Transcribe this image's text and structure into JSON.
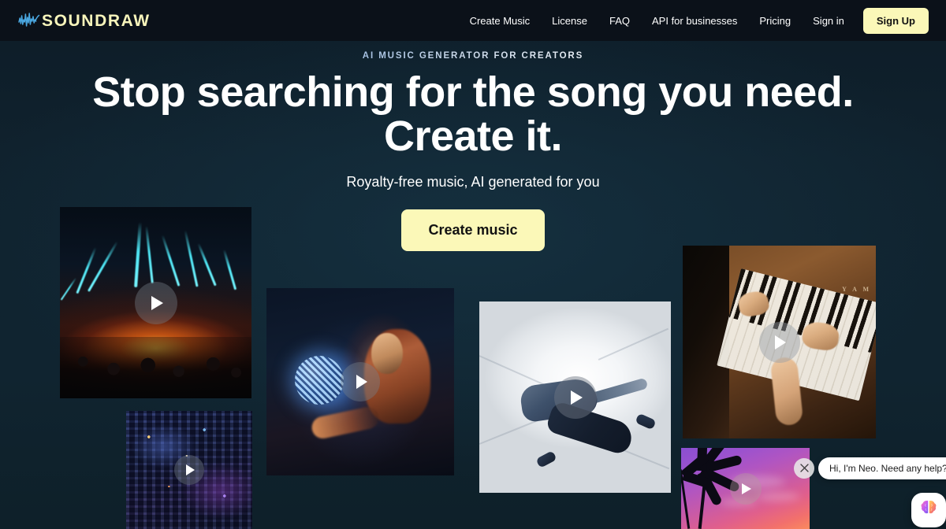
{
  "brand": {
    "name": "SOUNDRAW",
    "logo_icon": "waveform-icon",
    "logo_color": "#f8f5bb",
    "wave_color": "#4aa7e0"
  },
  "header": {
    "nav": [
      {
        "label": "Create Music",
        "name": "nav-create-music"
      },
      {
        "label": "License",
        "name": "nav-license"
      },
      {
        "label": "FAQ",
        "name": "nav-faq"
      },
      {
        "label": "API for businesses",
        "name": "nav-api-for-businesses"
      },
      {
        "label": "Pricing",
        "name": "nav-pricing"
      },
      {
        "label": "Sign in",
        "name": "nav-sign-in"
      }
    ],
    "signup_label": "Sign Up",
    "signup_bg": "#fbf8b8",
    "bg": "#0b1119"
  },
  "hero": {
    "eyebrow": "AI MUSIC GENERATOR FOR CREATORS",
    "headline_line1": "Stop searching for the song you need.",
    "headline_line2": "Create it.",
    "subtitle": "Royalty-free music, AI generated for you",
    "cta_label": "Create music",
    "cta_bg": "#fbf8b8",
    "bg": "#10222e"
  },
  "media_cards": [
    {
      "name": "card-concert",
      "alt": "Concert crowd with cyan laser beams and orange stage glow",
      "play_icon": "play-icon"
    },
    {
      "name": "card-city",
      "alt": "Night cityscape with blue and purple neon lights",
      "play_icon": "play-icon"
    },
    {
      "name": "card-disco",
      "alt": "Woman holding a mirror disco ball in dark blue light",
      "play_icon": "play-icon"
    },
    {
      "name": "card-dancer",
      "alt": "Breakdancer mid-move in a bright white corridor",
      "play_icon": "play-icon"
    },
    {
      "name": "card-piano",
      "alt": "Hands playing a wooden Yamaha upright piano",
      "play_icon": "play-icon"
    },
    {
      "name": "card-sunset",
      "alt": "Palm trees silhouetted against a purple and pink sunset",
      "play_icon": "play-icon"
    }
  ],
  "piano_brand": "Y A M",
  "chat": {
    "message": "Hi, I'm Neo. Need any help?",
    "close_icon": "close-icon",
    "avatar_icon": "brain-icon"
  }
}
